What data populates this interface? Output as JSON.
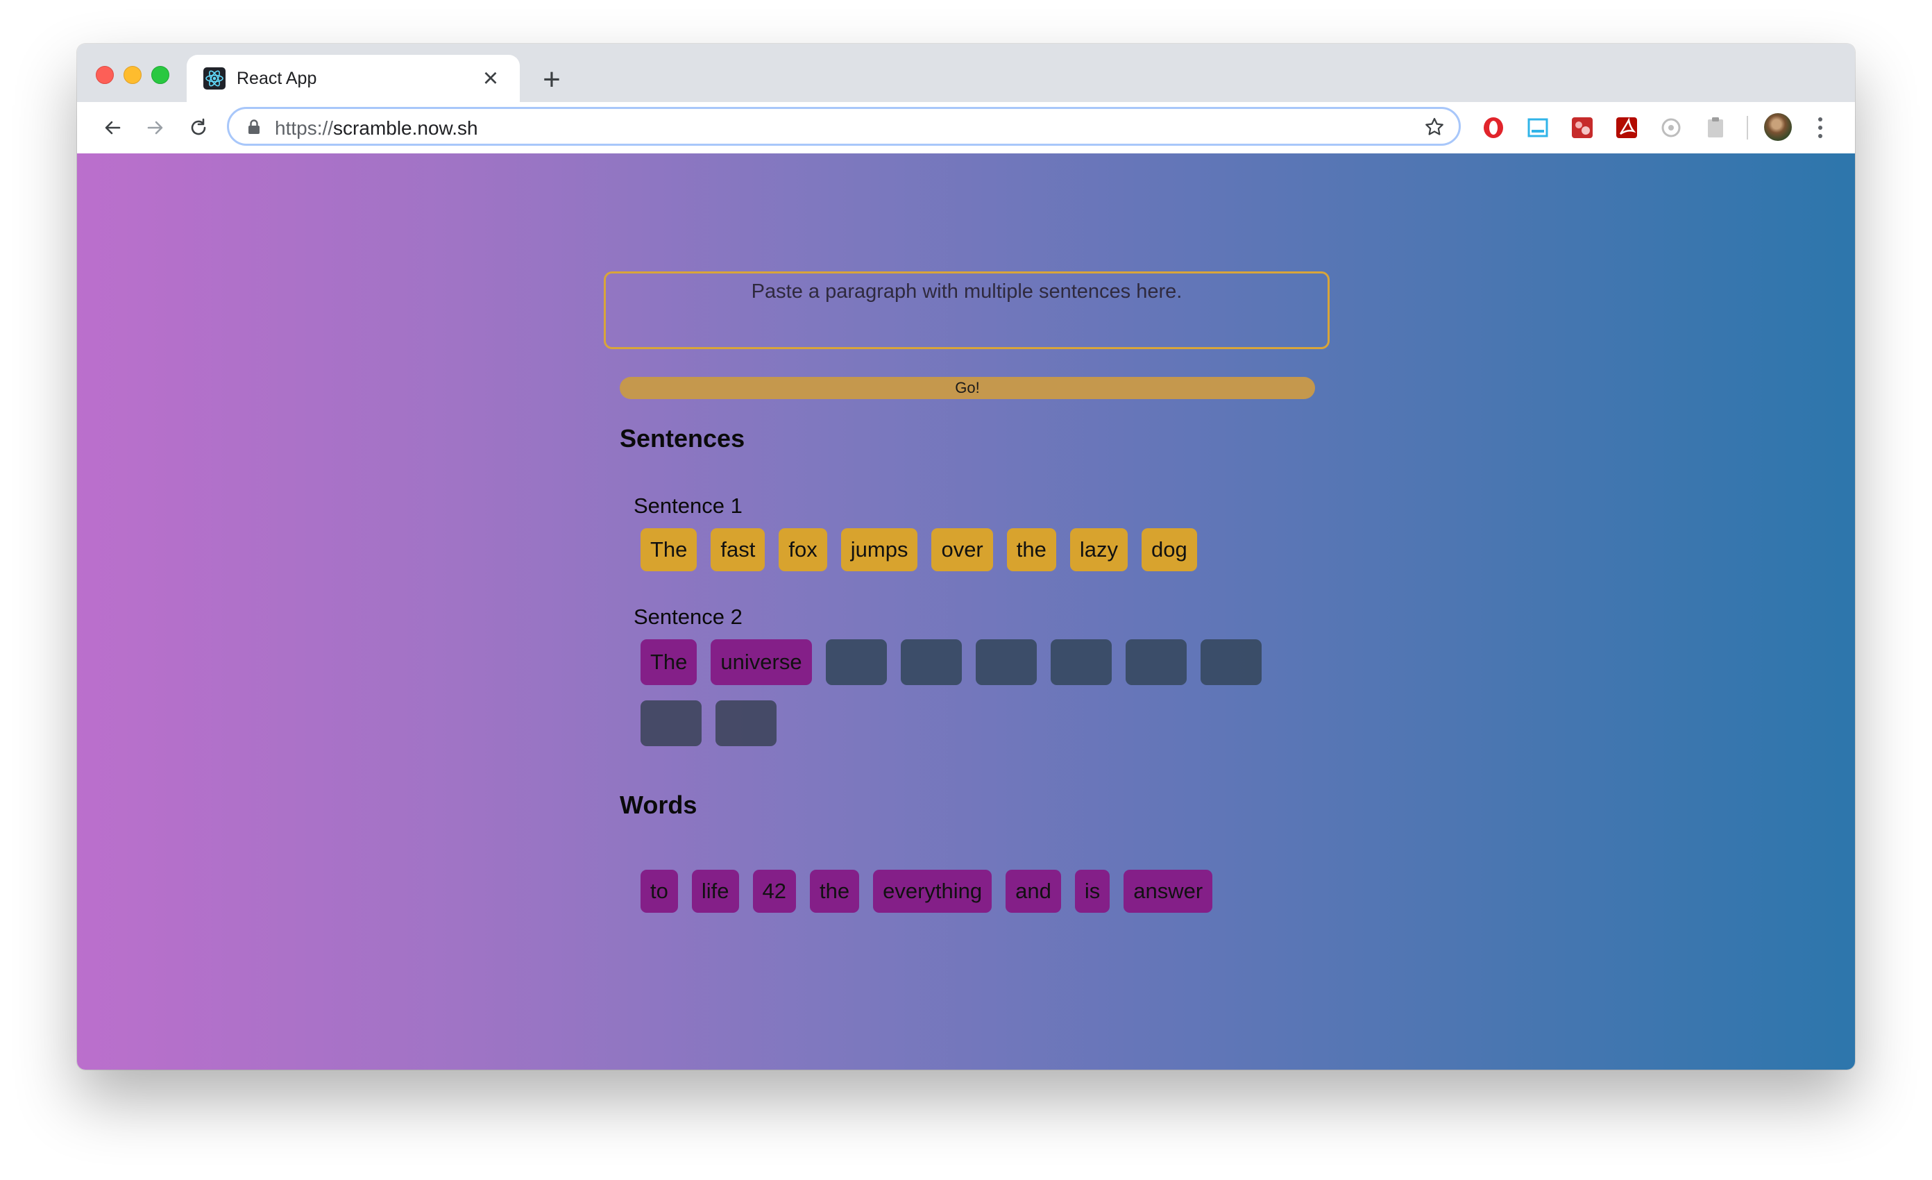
{
  "browser": {
    "tab_title": "React App",
    "tab_close_glyph": "×",
    "new_tab_glyph": "+",
    "url_scheme": "https://",
    "url_host": "scramble.now.sh",
    "extensions": [
      "opera-icon",
      "tab-icon",
      "photo-icon",
      "adobe-acrobat-icon",
      "gear-extension-icon",
      "clipboard-extension-icon"
    ]
  },
  "page": {
    "input_placeholder": "Paste a paragraph with multiple sentences here.",
    "go_label": "Go!",
    "sentences_heading": "Sentences",
    "words_heading": "Words",
    "sentences": [
      {
        "label": "Sentence 1",
        "words": [
          "The",
          "fast",
          "fox",
          "jumps",
          "over",
          "the",
          "lazy",
          "dog"
        ]
      },
      {
        "label": "Sentence 2",
        "placed_words": [
          "The",
          "universe"
        ],
        "empty_slots": 8
      }
    ],
    "word_bank": [
      "to",
      "life",
      "42",
      "the",
      "everything",
      "and",
      "is",
      "answer"
    ]
  },
  "colors": {
    "gradient_left": "#bb6fcc",
    "gradient_right": "#2d76ac",
    "solved_chip": "#d8a32e",
    "word_chip": "#841f88",
    "empty_slot": "#374a62",
    "go_button": "#c5984d",
    "input_border": "#d8a53a"
  }
}
